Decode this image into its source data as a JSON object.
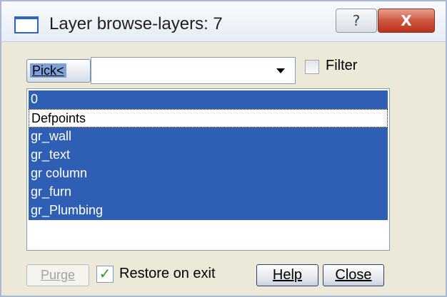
{
  "window": {
    "title": "Layer browse-layers: 7",
    "help_glyph": "?",
    "close_glyph": "X"
  },
  "toolbar": {
    "pick_label": "Pick<",
    "filter_label": "Filter",
    "filter_checked": false,
    "combo_value": ""
  },
  "layers": [
    {
      "name": "0",
      "state": "selected"
    },
    {
      "name": "Defpoints",
      "state": "focused"
    },
    {
      "name": "gr_wall",
      "state": "selected"
    },
    {
      "name": "gr_text",
      "state": "selected"
    },
    {
      "name": "gr column",
      "state": "selected"
    },
    {
      "name": "gr_furn",
      "state": "selected"
    },
    {
      "name": "gr_Plumbing",
      "state": "selected"
    }
  ],
  "footer": {
    "purge_label": "Purge",
    "restore_label": "Restore on exit",
    "restore_checked": true,
    "check_glyph": "✓",
    "help_label": "Help",
    "close_label": "Close"
  },
  "colors": {
    "selection": "#2f5eb5",
    "dialog_bg": "#ece9d8",
    "close_red": "#c9442d"
  }
}
